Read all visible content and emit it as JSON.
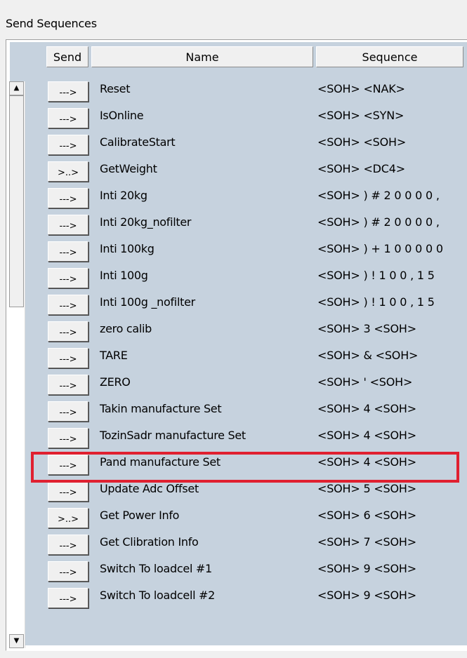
{
  "group": {
    "title": "Send Sequences"
  },
  "headers": {
    "send": "Send",
    "name": "Name",
    "sequence": "Sequence"
  },
  "scrollbar": {
    "up_glyph": "▲",
    "down_glyph": "▼"
  },
  "rows": [
    {
      "button": "--->",
      "name": "Reset",
      "sequence": "<SOH> <NAK>"
    },
    {
      "button": "--->",
      "name": "IsOnline",
      "sequence": "<SOH> <SYN>"
    },
    {
      "button": "--->",
      "name": "CalibrateStart",
      "sequence": "<SOH>  <SOH>"
    },
    {
      "button": ">..>",
      "name": "GetWeight",
      "sequence": "<SOH> <DC4>"
    },
    {
      "button": "--->",
      "name": "Inti 20kg",
      "sequence": "<SOH> ) # 2 0 0 0 0 ,"
    },
    {
      "button": "--->",
      "name": "Inti 20kg_nofilter",
      "sequence": "<SOH> ) # 2 0 0 0 0 ,"
    },
    {
      "button": "--->",
      "name": "Inti 100kg",
      "sequence": "<SOH> ) + 1 0 0 0 0 0"
    },
    {
      "button": "--->",
      "name": "Inti 100g",
      "sequence": "<SOH> ) ! 1 0 0 , 1 5"
    },
    {
      "button": "--->",
      "name": "Inti 100g _nofilter",
      "sequence": "<SOH> ) ! 1 0 0 , 1 5"
    },
    {
      "button": "--->",
      "name": "zero calib",
      "sequence": "<SOH> 3 <SOH>"
    },
    {
      "button": "--->",
      "name": "TARE",
      "sequence": "<SOH> & <SOH>"
    },
    {
      "button": "--->",
      "name": "ZERO",
      "sequence": "<SOH> ' <SOH>"
    },
    {
      "button": "--->",
      "name": "Takin manufacture Set",
      "sequence": "<SOH> 4 <SOH>"
    },
    {
      "button": "--->",
      "name": "TozinSadr manufacture Set",
      "sequence": "<SOH> 4 <SOH>"
    },
    {
      "button": "--->",
      "name": "Pand manufacture Set",
      "sequence": "<SOH> 4 <SOH>"
    },
    {
      "button": "--->",
      "name": "Update Adc Offset",
      "sequence": "<SOH> 5 <SOH>"
    },
    {
      "button": ">..>",
      "name": "Get Power Info",
      "sequence": "<SOH> 6 <SOH>"
    },
    {
      "button": "--->",
      "name": "Get Clibration Info",
      "sequence": "<SOH> 7 <SOH>"
    },
    {
      "button": "--->",
      "name": "Switch To loadcel #1",
      "sequence": "<SOH> 9 <SOH>"
    },
    {
      "button": "--->",
      "name": "Switch To loadcell #2",
      "sequence": "<SOH> 9 <SOH>"
    }
  ],
  "highlight_color": "#e02030"
}
